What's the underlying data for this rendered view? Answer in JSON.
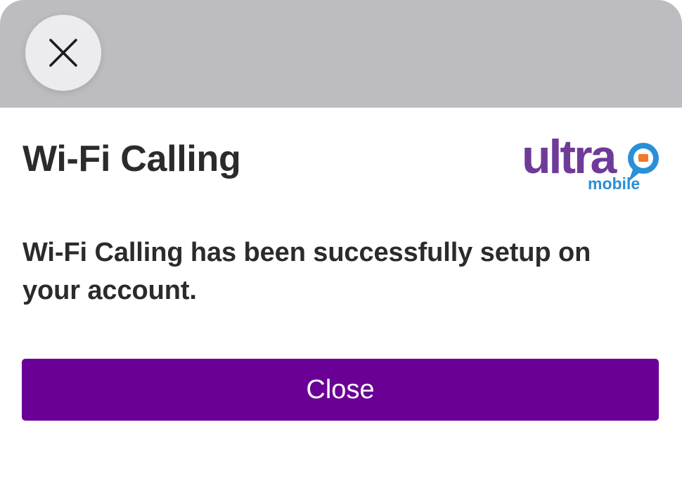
{
  "header": {
    "close_icon": "close-icon"
  },
  "dialog": {
    "title": "Wi-Fi Calling",
    "message": "Wi-Fi Calling has been successfully setup on your account.",
    "button_label": "Close"
  },
  "logo": {
    "wordmark": "ultra",
    "sub": "mobile",
    "icon": "speech-bubble-icon",
    "colors": {
      "wordmark": "#6f3a98",
      "sub": "#2a8fd6",
      "bubble": "#2a8fd6",
      "bubble_accent": "#f07a2c"
    }
  },
  "colors": {
    "header_bg": "#bdbcc1",
    "primary": "#6a0095",
    "text": "#2b2b2b"
  }
}
